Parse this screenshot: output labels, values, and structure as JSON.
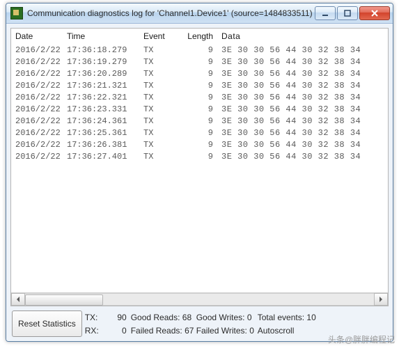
{
  "window": {
    "title": "Communication diagnostics log for 'Channel1.Device1' (source=1484833511)"
  },
  "columns": {
    "date": "Date",
    "time": "Time",
    "event": "Event",
    "length": "Length",
    "data": "Data"
  },
  "rows": [
    {
      "date": "2016/2/22",
      "time": "17:36:18.279",
      "event": "TX",
      "length": "9",
      "data": "3E 30 30 56 44 30 32 38 34"
    },
    {
      "date": "2016/2/22",
      "time": "17:36:19.279",
      "event": "TX",
      "length": "9",
      "data": "3E 30 30 56 44 30 32 38 34"
    },
    {
      "date": "2016/2/22",
      "time": "17:36:20.289",
      "event": "TX",
      "length": "9",
      "data": "3E 30 30 56 44 30 32 38 34"
    },
    {
      "date": "2016/2/22",
      "time": "17:36:21.321",
      "event": "TX",
      "length": "9",
      "data": "3E 30 30 56 44 30 32 38 34"
    },
    {
      "date": "2016/2/22",
      "time": "17:36:22.321",
      "event": "TX",
      "length": "9",
      "data": "3E 30 30 56 44 30 32 38 34"
    },
    {
      "date": "2016/2/22",
      "time": "17:36:23.331",
      "event": "TX",
      "length": "9",
      "data": "3E 30 30 56 44 30 32 38 34"
    },
    {
      "date": "2016/2/22",
      "time": "17:36:24.361",
      "event": "TX",
      "length": "9",
      "data": "3E 30 30 56 44 30 32 38 34"
    },
    {
      "date": "2016/2/22",
      "time": "17:36:25.361",
      "event": "TX",
      "length": "9",
      "data": "3E 30 30 56 44 30 32 38 34"
    },
    {
      "date": "2016/2/22",
      "time": "17:36:26.381",
      "event": "TX",
      "length": "9",
      "data": "3E 30 30 56 44 30 32 38 34"
    },
    {
      "date": "2016/2/22",
      "time": "17:36:27.401",
      "event": "TX",
      "length": "9",
      "data": "3E 30 30 56 44 30 32 38 34"
    }
  ],
  "status": {
    "reset_label": "Reset Statistics",
    "tx_label": "TX:",
    "tx_value": "90",
    "rx_label": "RX:",
    "rx_value": "0",
    "good_reads_label": "Good Reads:",
    "good_reads_value": "68",
    "failed_reads_label": "Failed Reads:",
    "failed_reads_value": "67",
    "good_writes_label": "Good Writes:",
    "good_writes_value": "0",
    "failed_writes_label": "Failed Writes:",
    "failed_writes_value": "0",
    "total_events_label": "Total events:",
    "total_events_value": "10",
    "autoscroll_label": "Autoscroll"
  },
  "watermark": "头条@胖胖编程记"
}
